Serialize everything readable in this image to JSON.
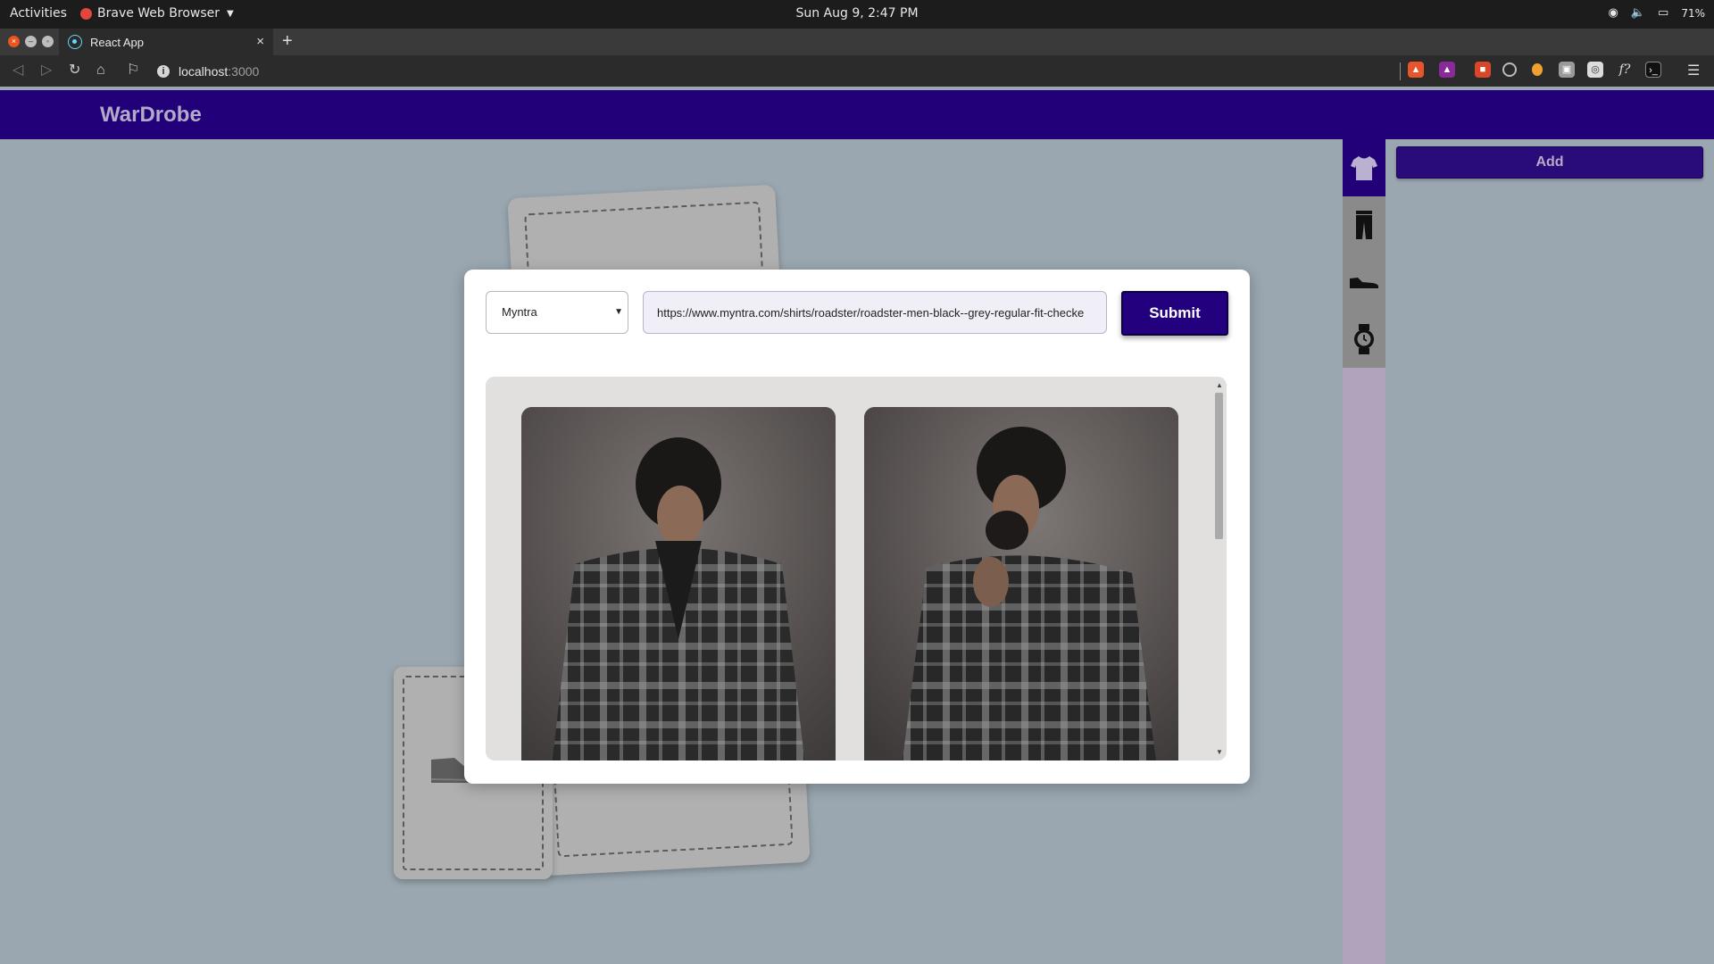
{
  "system_bar": {
    "activities": "Activities",
    "app_name": "Brave Web Browser",
    "clock": "Sun Aug  9,  2:47 PM",
    "battery": "71%"
  },
  "browser": {
    "tab_title": "React App",
    "url_host": "localhost",
    "url_port": ":3000",
    "new_tab": "+"
  },
  "app": {
    "title": "WarDrobe",
    "add_label": "Add",
    "categories": [
      {
        "name": "tops",
        "icon": "tshirt-icon",
        "active": true
      },
      {
        "name": "bottoms",
        "icon": "trousers-icon",
        "active": false
      },
      {
        "name": "shoes",
        "icon": "shoe-icon",
        "active": false
      },
      {
        "name": "watches",
        "icon": "watch-icon",
        "active": false
      }
    ]
  },
  "modal": {
    "store_selected": "Myntra",
    "url_value": "https://www.myntra.com/shirts/roadster/roadster-men-black--grey-regular-fit-checke",
    "submit_label": "Submit"
  },
  "colors": {
    "header": "#22007a",
    "accent": "#22007e",
    "background": "#9aa7b0"
  }
}
